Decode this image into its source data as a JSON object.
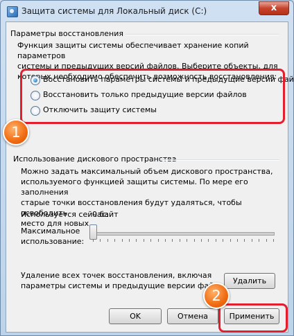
{
  "window": {
    "title": "Защита системы для Локальный диск (C:)",
    "close_label": "x"
  },
  "restore": {
    "group_title": "Параметры восстановления",
    "description": [
      "Функция защиты системы обеспечивает хранение копий параметров",
      "системы и предыдущих версий файлов. Выберите объекты, для",
      "которых необходимо обеспечить возможность восстановления:"
    ],
    "options": [
      {
        "label": "Восстановить параметры системы и предыдущие версии файлов",
        "checked": true
      },
      {
        "label": "Восстановить только предыдущие версии файлов",
        "checked": false
      },
      {
        "label": "Отключить защиту системы",
        "checked": false
      }
    ]
  },
  "disk": {
    "group_title": "Использование дискового пространства",
    "description": [
      "Можно задать максимальный объем дискового пространства,",
      "используемого функцией защиты системы. По мере его заполнения",
      "старые точки восстановления будут удаляться, чтобы освободить",
      "место для новых."
    ],
    "current_label": "Используется сейчас:",
    "current_value": "0 байт",
    "max_label": [
      "Максимальное",
      "использование:"
    ],
    "slider_value": 0
  },
  "delete": {
    "text": [
      "Удаление всех точек восстановления, включая",
      "параметры системы и предыдущие версии файлов."
    ],
    "button": "Удалить"
  },
  "buttons": {
    "ok": "OK",
    "cancel": "Отмена",
    "apply": "Применить"
  },
  "annotations": {
    "badge1": "1",
    "badge2": "2",
    "color": "#e31e2d",
    "badge_color": "#f06a10"
  }
}
